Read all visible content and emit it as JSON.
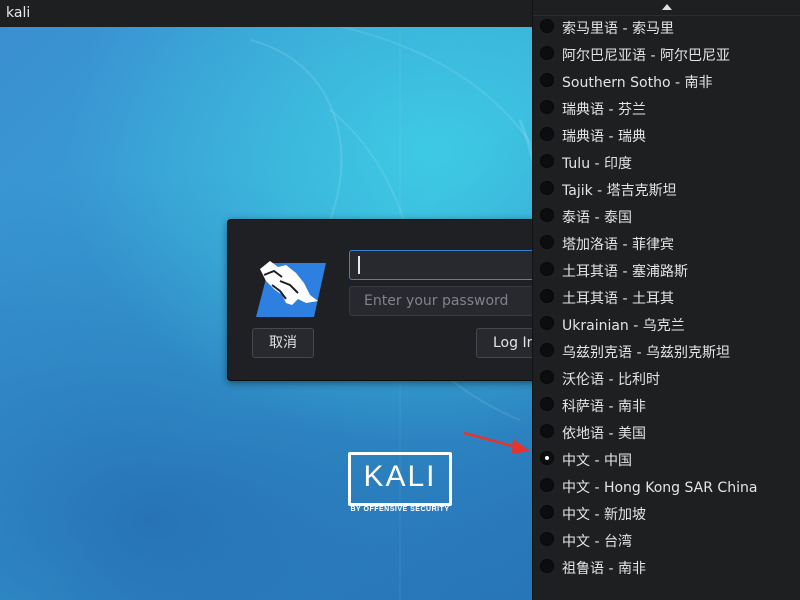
{
  "topbar": {
    "title": "kali"
  },
  "login": {
    "username_value": "",
    "password_placeholder": "Enter your password",
    "cancel_label": "取消",
    "login_label": "Log In"
  },
  "brand": {
    "name": "KALI",
    "tagline": "BY OFFENSIVE SECURITY"
  },
  "language_menu": {
    "items": [
      {
        "label": "索马里语 - 索马里",
        "selected": false
      },
      {
        "label": "阿尔巴尼亚语 - 阿尔巴尼亚",
        "selected": false
      },
      {
        "label": "Southern Sotho - 南非",
        "selected": false
      },
      {
        "label": "瑞典语 - 芬兰",
        "selected": false
      },
      {
        "label": "瑞典语 - 瑞典",
        "selected": false
      },
      {
        "label": "Tulu - 印度",
        "selected": false
      },
      {
        "label": "Tajik - 塔吉克斯坦",
        "selected": false
      },
      {
        "label": "泰语 - 泰国",
        "selected": false
      },
      {
        "label": "塔加洛语 - 菲律宾",
        "selected": false
      },
      {
        "label": "土耳其语 - 塞浦路斯",
        "selected": false
      },
      {
        "label": "土耳其语 - 土耳其",
        "selected": false
      },
      {
        "label": "Ukrainian - 乌克兰",
        "selected": false
      },
      {
        "label": "乌兹别克语 - 乌兹别克斯坦",
        "selected": false
      },
      {
        "label": "沃伦语 - 比利时",
        "selected": false
      },
      {
        "label": "科萨语 - 南非",
        "selected": false
      },
      {
        "label": "依地语 - 美国",
        "selected": false
      },
      {
        "label": "中文 - 中国",
        "selected": true
      },
      {
        "label": "中文 - Hong Kong SAR China",
        "selected": false
      },
      {
        "label": "中文 - 新加坡",
        "selected": false
      },
      {
        "label": "中文 - 台湾",
        "selected": false
      },
      {
        "label": "祖鲁语 - 南非",
        "selected": false
      }
    ]
  },
  "colors": {
    "panel_bg": "#1f2024",
    "menu_bg": "#1e1f21",
    "focus_border": "#3f7fd8",
    "annotation_arrow": "#e8322c"
  }
}
